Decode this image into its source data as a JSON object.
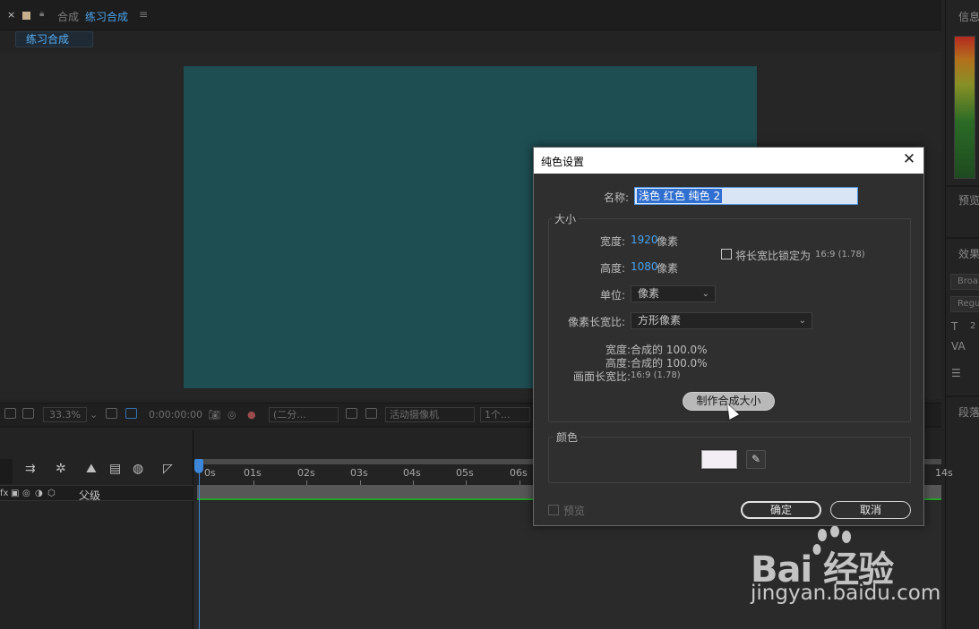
{
  "comp_panel": {
    "tab_close": "×",
    "tab_kind": "合成",
    "tab_name": "练习合成",
    "tab_menu": "≡",
    "subtab": "练习合成",
    "canvas_color": "#1e4d52"
  },
  "viewer_toolbar": {
    "zoom": "33.3%",
    "timecode": "0:00:00:00",
    "resolution": "(二分...",
    "camera": "活动摄像机",
    "views": "1个..."
  },
  "right_panel": {
    "info_title": "信息",
    "preview_title": "预览",
    "effects_title": "效果",
    "font_family": "Broa",
    "font_style": "Regu",
    "size_value": "2",
    "paragraph_title": "段落"
  },
  "timeline": {
    "parent_label": "父级",
    "ticks": [
      "0s",
      "01s",
      "02s",
      "03s",
      "04s",
      "05s",
      "06s",
      "14s"
    ]
  },
  "dialog": {
    "title": "纯色设置",
    "close": "✕",
    "name_label": "名称:",
    "name_value": "浅色 红色 纯色 2",
    "size_section": "大小",
    "width_label": "宽度:",
    "width_value": "1920",
    "width_unit": "像素",
    "height_label": "高度:",
    "height_value": "1080",
    "height_unit": "像素",
    "lock_ratio_label": "将长宽比锁定为",
    "lock_ratio_value": "16:9 (1.78)",
    "lock_ratio_checked": false,
    "units_label": "单位:",
    "units_value": "像素",
    "pixel_aspect_label": "像素长宽比:",
    "pixel_aspect_value": "方形像素",
    "pct_width_label": "宽度:",
    "pct_width_value": "合成的 100.0%",
    "pct_height_label": "高度:",
    "pct_height_value": "合成的 100.0%",
    "frame_aspect_label": "画面长宽比:",
    "frame_aspect_value": "16:9 (1.78)",
    "make_comp_size": "制作合成大小",
    "color_section": "颜色",
    "color_value": "#f3eef3",
    "preview_label": "预览",
    "preview_checked": false,
    "ok": "确定",
    "cancel": "取消"
  },
  "watermark": {
    "logo": "Bai 经验",
    "url": "jingyan.baidu.com"
  }
}
